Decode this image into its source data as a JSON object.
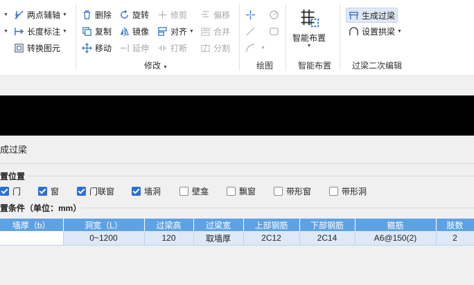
{
  "ribbon": {
    "col1": {
      "axis": "两点辅轴",
      "length_dim": "长度标注",
      "convert": "转换图元"
    },
    "modify": {
      "delete": "删除",
      "rotate": "旋转",
      "trim": "修剪",
      "offset": "偏移",
      "copy": "复制",
      "mirror": "镜像",
      "align": "对齐",
      "merge": "合并",
      "move": "移动",
      "extend": "延伸",
      "break": "打断",
      "split": "分割",
      "group_label": "修改"
    },
    "draw": {
      "group_label": "绘图"
    },
    "smart": {
      "button": "智能布置",
      "group_label": "智能布置"
    },
    "lintel": {
      "generate": "生成过梁",
      "set_arch": "设置拱梁",
      "group_label": "过梁二次编辑"
    }
  },
  "panel": {
    "title": "成过梁",
    "section_position": "置位置",
    "checkboxes": [
      {
        "label": "门",
        "checked": true
      },
      {
        "label": "窗",
        "checked": true
      },
      {
        "label": "门联窗",
        "checked": true
      },
      {
        "label": "墙洞",
        "checked": true
      },
      {
        "label": "壁龛",
        "checked": false
      },
      {
        "label": "飘窗",
        "checked": false
      },
      {
        "label": "带形窗",
        "checked": false
      },
      {
        "label": "带形洞",
        "checked": false
      }
    ],
    "section_condition": "置条件（单位：mm）",
    "table": {
      "headers": [
        "墙厚（b）",
        "洞宽（L）",
        "过梁高",
        "过梁宽",
        "上部钢筋",
        "下部钢筋",
        "箍筋",
        "肢数"
      ],
      "rows": [
        [
          "",
          "0~1200",
          "120",
          "取墙厚",
          "2C12",
          "2C14",
          "A6@150(2)",
          "2"
        ]
      ]
    }
  }
}
